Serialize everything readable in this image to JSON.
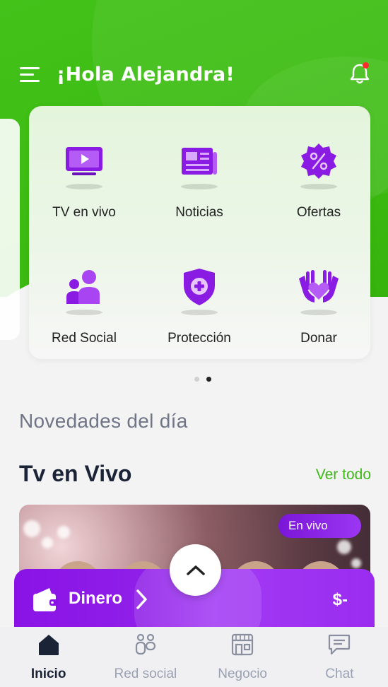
{
  "header": {
    "greeting": "¡Hola Alejandra!",
    "menu_icon": "hamburger-menu-icon",
    "bell_icon": "bell-icon",
    "notification_dot_color": "#ff2b2b",
    "brand_green": "#3cbc12"
  },
  "quick_access": {
    "items": [
      {
        "label": "TV en vivo",
        "icon": "tv-icon"
      },
      {
        "label": "Noticias",
        "icon": "newspaper-icon"
      },
      {
        "label": "Ofertas",
        "icon": "discount-badge-icon"
      },
      {
        "label": "Red Social",
        "icon": "people-icon"
      },
      {
        "label": "Protección",
        "icon": "shield-plus-icon"
      },
      {
        "label": "Donar",
        "icon": "heart-hands-icon"
      }
    ],
    "page_count": 2,
    "active_page": 2,
    "icon_color": "#8a1be2"
  },
  "news": {
    "title": "Novedades del día"
  },
  "tv_section": {
    "title": "Tv en Vivo",
    "see_all": "Ver todo",
    "badge": "En vivo"
  },
  "money": {
    "label": "Dinero",
    "amount": "$-",
    "wallet_icon": "wallet-icon"
  },
  "bottom_nav": {
    "items": [
      {
        "label": "Inicio",
        "icon": "home-icon",
        "active": true
      },
      {
        "label": "Red social",
        "icon": "social-icon",
        "active": false
      },
      {
        "label": "Negocio",
        "icon": "store-icon",
        "active": false
      },
      {
        "label": "Chat",
        "icon": "chat-icon",
        "active": false
      }
    ]
  }
}
